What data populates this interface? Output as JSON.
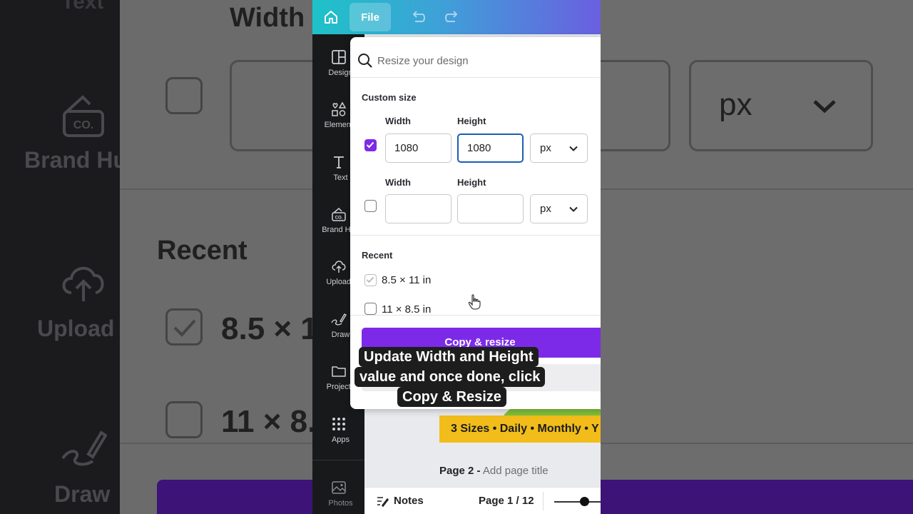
{
  "background": {
    "texts": {
      "text_top": "Text",
      "width": "Width",
      "brand": "Brand Hu",
      "recent": "Recent",
      "upload": "Upload",
      "size1": "8.5 × 1",
      "size2": "11 × 8.",
      "draw": "Draw",
      "unit": "px"
    }
  },
  "topbar": {
    "file_label": "File"
  },
  "sidebar": {
    "items": [
      {
        "label": "Design",
        "icon": "layout-icon"
      },
      {
        "label": "Elements",
        "icon": "shapes-icon"
      },
      {
        "label": "Text",
        "icon": "text-icon"
      },
      {
        "label": "Brand Hub",
        "icon": "brand-hub-icon"
      },
      {
        "label": "Uploads",
        "icon": "upload-cloud-icon"
      },
      {
        "label": "Draw",
        "icon": "draw-icon"
      },
      {
        "label": "Projects",
        "icon": "folder-icon"
      },
      {
        "label": "Apps",
        "icon": "apps-grid-icon"
      },
      {
        "label": "Photos",
        "icon": "photos-icon"
      }
    ]
  },
  "resize_panel": {
    "search_placeholder": "Resize your design",
    "custom_size_title": "Custom size",
    "rows": [
      {
        "checked": true,
        "width_label": "Width",
        "height_label": "Height",
        "width": "1080",
        "height": "1080",
        "unit": "px"
      },
      {
        "checked": false,
        "width_label": "Width",
        "height_label": "Height",
        "width": "",
        "height": "",
        "unit": "px"
      }
    ],
    "recent_title": "Recent",
    "recent": [
      {
        "label": "8.5 × 11 in",
        "checked": false
      },
      {
        "label": "11 × 8.5 in",
        "checked": false
      }
    ],
    "cta_label": "Copy & resize"
  },
  "canvas": {
    "banner_text": "3 Sizes • Daily • Monthly • Y",
    "page_prefix": "Page 2 -",
    "page_title_placeholder": "Add page title"
  },
  "bottombar": {
    "notes_label": "Notes",
    "page_indicator": "Page 1 / 12"
  },
  "caption": {
    "line1": "Update Width and Height",
    "line2": "value and once done, click",
    "line3": "Copy & Resize"
  },
  "colors": {
    "accent": "#7d2ae8",
    "focus": "#1a5fb4",
    "banner": "#f2bd1a"
  }
}
